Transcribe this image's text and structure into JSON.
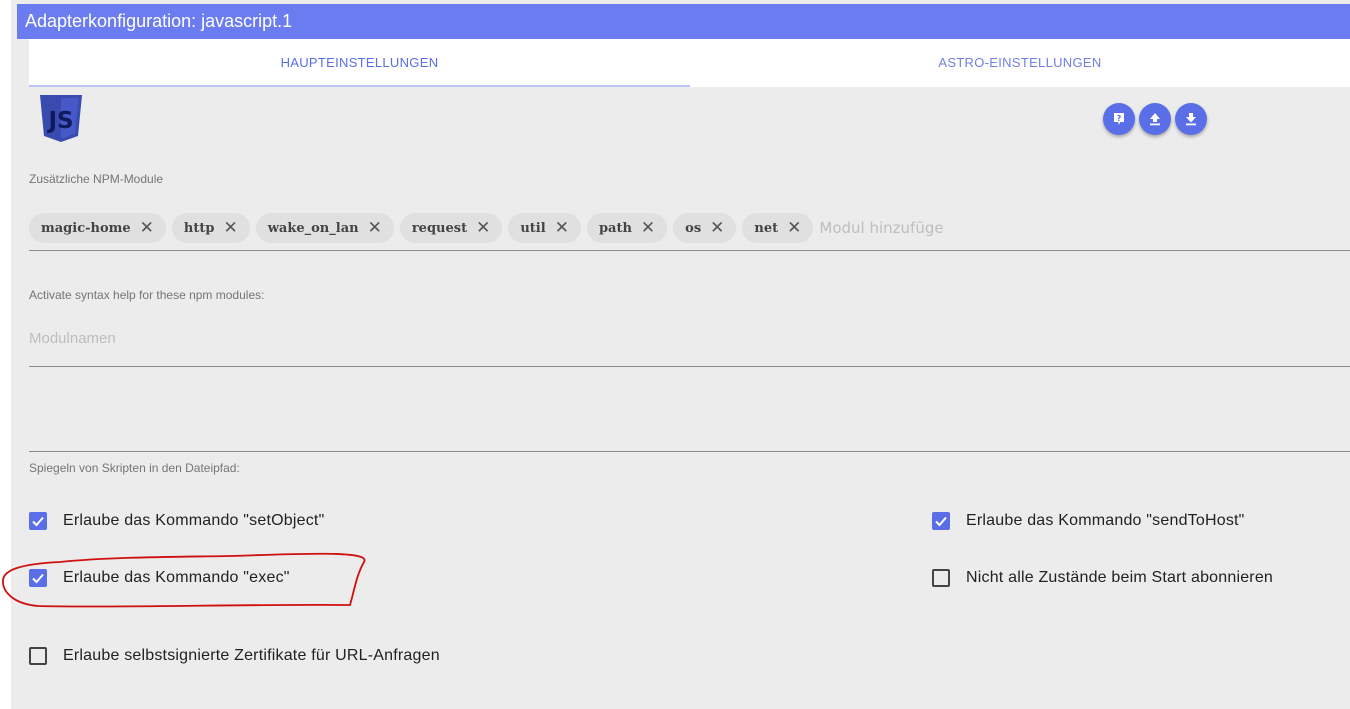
{
  "window": {
    "title": "Adapterkonfiguration: javascript.1"
  },
  "tabs": [
    {
      "label": "HAUPTEINSTELLUNGEN"
    },
    {
      "label": "ASTRO-EINSTELLUNGEN"
    }
  ],
  "logo": {
    "text": "JS"
  },
  "actions": {
    "icons": [
      "help-icon",
      "upload-icon",
      "download-icon"
    ]
  },
  "npm": {
    "label": "Zusätzliche NPM-Module",
    "chips": [
      {
        "label": "magic-home"
      },
      {
        "label": "http"
      },
      {
        "label": "wake_on_lan"
      },
      {
        "label": "request"
      },
      {
        "label": "util"
      },
      {
        "label": "path"
      },
      {
        "label": "os"
      },
      {
        "label": "net"
      }
    ],
    "placeholder": "Modul hinzufüge"
  },
  "syntax": {
    "label": "Activate syntax help for these npm modules:",
    "placeholder": "Modulnamen"
  },
  "mirror": {
    "label": "Spiegeln von Skripten in den Dateipfad:"
  },
  "options": {
    "setObject": {
      "label": "Erlaube das Kommando \"setObject\"",
      "checked": true
    },
    "sendToHost": {
      "label": "Erlaube das Kommando \"sendToHost\"",
      "checked": true
    },
    "exec": {
      "label": "Erlaube das Kommando \"exec\"",
      "checked": true
    },
    "noSubscribe": {
      "label": "Nicht alle Zustände beim Start abonnieren",
      "checked": false
    },
    "selfSigned": {
      "label": "Erlaube selbstsignierte Zertifikate für URL-Anfragen",
      "checked": false
    }
  },
  "colors": {
    "accent": "#6b7bf0",
    "background": "#ececec",
    "annotation": "#d01010"
  }
}
